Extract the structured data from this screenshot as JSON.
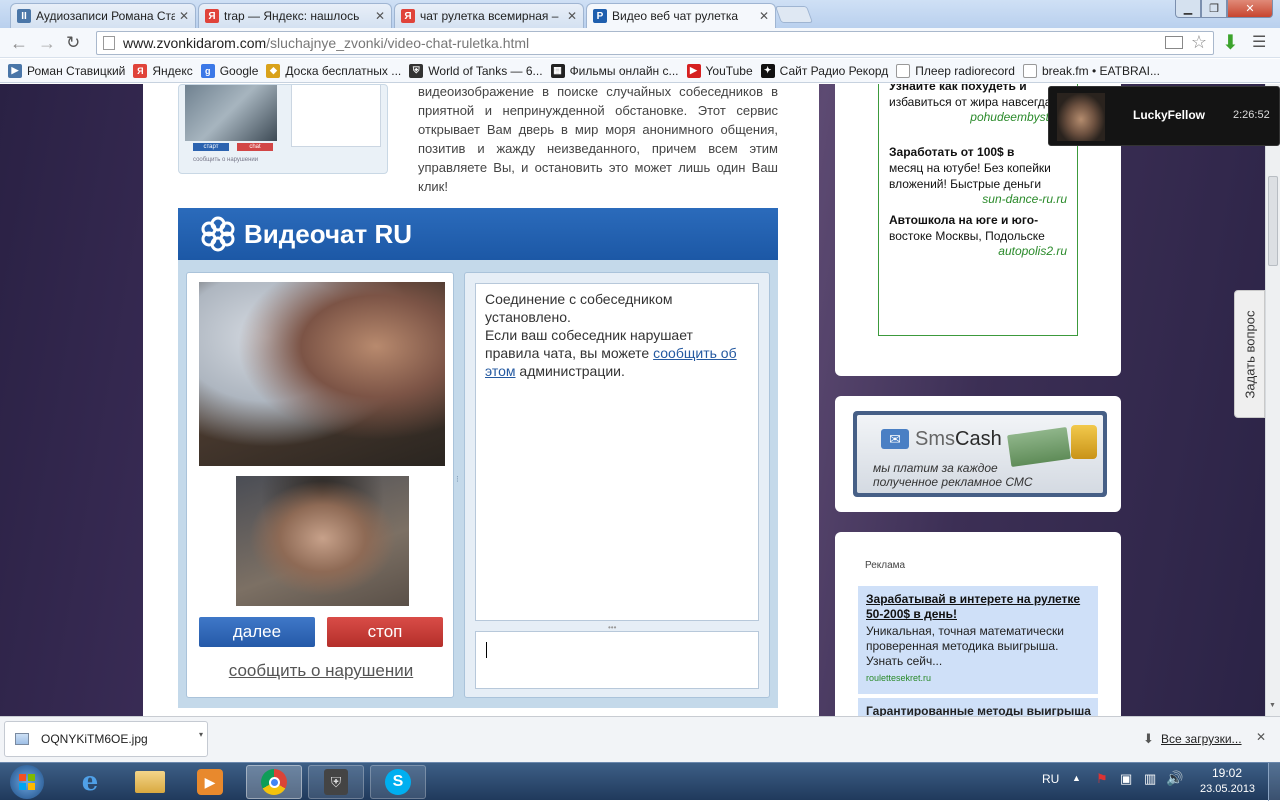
{
  "browser": {
    "tabs": [
      {
        "label": "Аудиозаписи Романа Ста",
        "favicon": "II"
      },
      {
        "label": "trap — Яндекс: нашлось",
        "favicon": "Я"
      },
      {
        "label": "чат рулетка всемирная –",
        "favicon": "Я"
      },
      {
        "label": "Видео веб чат рулетка",
        "favicon": "P"
      }
    ],
    "url_host": "www.zvonkidarom.com",
    "url_path": "/sluchajnye_zvonki/video-chat-ruletka.html",
    "bookmarks": [
      {
        "label": "Роман Ставицкий"
      },
      {
        "label": "Яндекс"
      },
      {
        "label": "Google"
      },
      {
        "label": "Доска бесплатных ..."
      },
      {
        "label": "World of Tanks — 6..."
      },
      {
        "label": "Фильмы онлайн с..."
      },
      {
        "label": "YouTube"
      },
      {
        "label": "Сайт Радио Рекорд"
      },
      {
        "label": "Плеер radiorecord"
      },
      {
        "label": "break.fm • EATBRAI..."
      }
    ]
  },
  "page": {
    "thumb_start": "старт",
    "thumb_chat": "chat",
    "thumb_text": "сообщить о нарушении",
    "intro_text": "видеоизображение в поиске случайных собеседников в приятной и непринужденной обстановке. Этот сервис открывает Вам дверь в мир моря анонимного общения, позитив и жажду неизведанного, причем всем этим управляете Вы, и остановить это может лишь один Ваш клик!",
    "videochat_title": "Видеочат RU",
    "next_button": "далее",
    "stop_button": "стоп",
    "report_link": "сообщить о нарушении",
    "chat_msg_1": "Соединение с собеседником установлено.",
    "chat_msg_2a": "Если ваш собеседник нарушает правила чата, вы можете ",
    "chat_msg_link": "сообщить об этом",
    "chat_msg_2b": " администрации."
  },
  "sidebar": {
    "ads": [
      {
        "text_bold": "Узнайте как похудеть и",
        "text": "избавиться от жира навсегда!",
        "link": "pohudeembystro.r"
      },
      {
        "text_bold": "Заработать от 100$ в",
        "text": "месяц на ютубе! Без копейки вложений! Быстрые деньги",
        "link": "sun-dance-ru.ru"
      },
      {
        "text_bold": "Автошкола на юге и юго-",
        "text": "востоке Москвы, Подольске",
        "link": "autopolis2.ru"
      }
    ],
    "smscash_brand_sms": "Sms",
    "smscash_brand_cash": "Cash",
    "smscash_tagline": "мы платим за каждое полученное рекламное СМС",
    "ad_label": "Реклама",
    "ad_block_title": "Зарабатывай в интерете на рулетке 50-200$ в день!",
    "ad_block_text": "Уникальная, точная математически проверенная методика выигрыша. Узнать сейч...",
    "ad_block_url": "roulettesekret.ru",
    "ad_block2_title": "Гарантированные методы выигрыша"
  },
  "feedback_tab": "Задать вопрос",
  "notification": {
    "name": "LuckyFellow",
    "time": "2:26:52"
  },
  "downloads": {
    "file": "OQNYKiTM6OE.jpg",
    "all": "Все загрузки..."
  },
  "taskbar": {
    "lang": "RU",
    "time": "19:02",
    "date": "23.05.2013"
  }
}
